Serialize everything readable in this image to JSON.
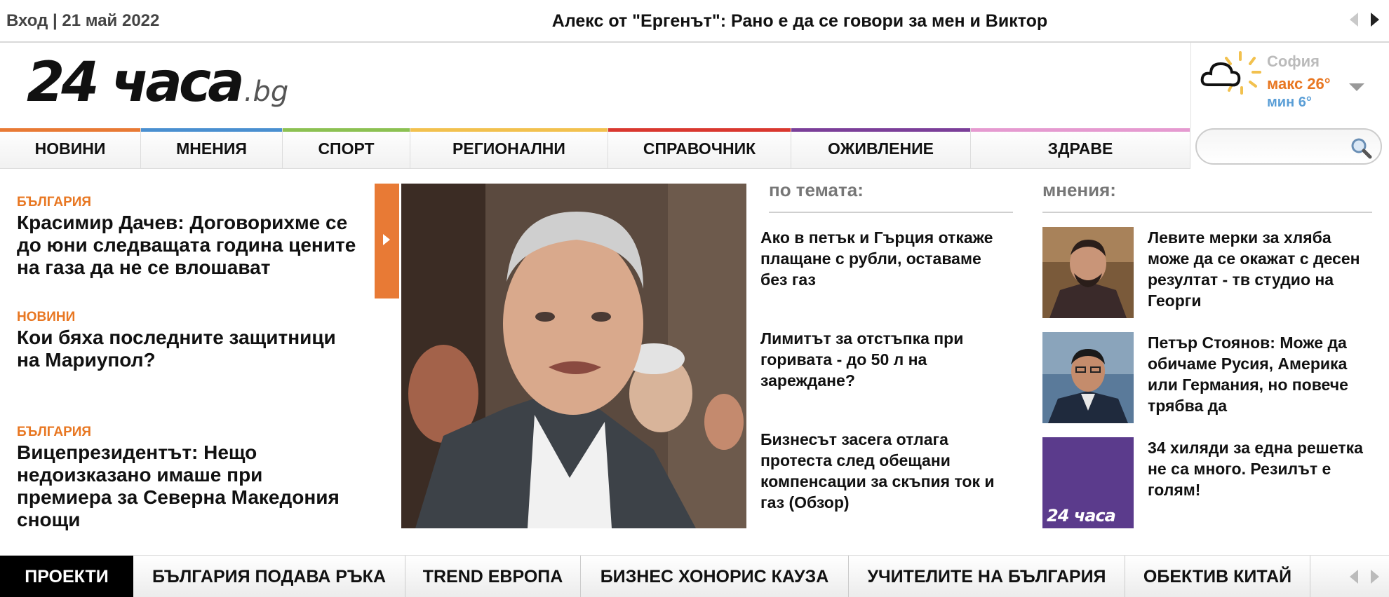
{
  "topbar": {
    "login": "Вход",
    "separator": " | ",
    "date": "21 май 2022",
    "headline": "Алекс от \"Ергенът\": Рано е да се говори за мен и Виктор"
  },
  "logo": {
    "main": "24 часа",
    "tld": ".bg"
  },
  "weather": {
    "city": "София",
    "max": "макс 26°",
    "min": "мин 6°",
    "icon": "partly-sunny-icon"
  },
  "nav": [
    {
      "label": "НОВИНИ",
      "color": "#e87a35"
    },
    {
      "label": "МНЕНИЯ",
      "color": "#4a8fd0"
    },
    {
      "label": "СПОРТ",
      "color": "#8cc152"
    },
    {
      "label": "РЕГИОНАЛНИ",
      "color": "#f2c14e"
    },
    {
      "label": "СПРАВОЧНИК",
      "color": "#d9382f"
    },
    {
      "label": "ОЖИВЛЕНИЕ",
      "color": "#7b3f99"
    },
    {
      "label": "ЗДРАВЕ",
      "color": "#e59ad0"
    }
  ],
  "search": {
    "placeholder": ""
  },
  "left_stories": [
    {
      "category": "БЪЛГАРИЯ",
      "title": "Красимир Дачев: Договорихме се до юни следващата година цените на газа да не се влошават"
    },
    {
      "category": "НОВИНИ",
      "title": "Кои бяха последните защитници на Мариупол?"
    },
    {
      "category": "БЪЛГАРИЯ",
      "title": "Вицепрезидентът: Нещо недоизказано имаше при премиера за Северна Македония снощи"
    }
  ],
  "on_topic": {
    "heading": "по темата:",
    "items": [
      "Ако в петък и Гърция откаже плащане с рубли, оставаме без газ",
      "Лимитът за отстъпка при горивата - до 50 л на зареждане?",
      "Бизнесът засега отлага протеста след обещани компенсации за скъпия ток и газ (Обзор)"
    ]
  },
  "opinions": {
    "heading": "мнения:",
    "items": [
      "Левите мерки за хляба може да се окажат с десен резултат - тв студио на Георги",
      "Петър Стоянов: Може да обичаме Русия, Америка или Германия, но повече трябва да",
      "34 хиляди за една решетка не са много. Резилът е голям!"
    ],
    "thumb3_logo": "24 часа"
  },
  "projects": {
    "label": "ПРОЕКТИ",
    "items": [
      "БЪЛГАРИЯ ПОДАВА РЪКА",
      "TREND ЕВРОПА",
      "БИЗНЕС ХОНОРИС КАУЗА",
      "УЧИТЕЛИТЕ НА БЪЛГАРИЯ",
      "ОБЕКТИВ КИТАЙ"
    ]
  }
}
